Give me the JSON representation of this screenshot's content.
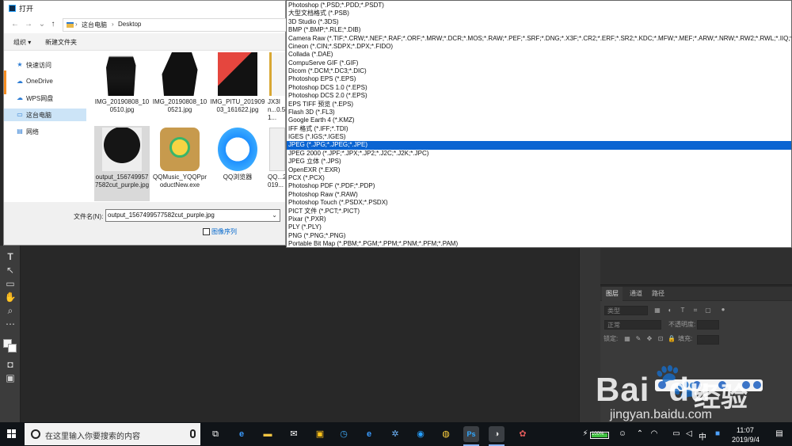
{
  "dialog": {
    "title": "打开",
    "breadcrumb": [
      "这台电脑",
      "Desktop"
    ],
    "organize_label": "组织 ▾",
    "new_folder_label": "新建文件夹",
    "nav_items": [
      {
        "label": "快速访问",
        "icon": "star-icon"
      },
      {
        "label": "OneDrive",
        "icon": "cloud-icon"
      },
      {
        "label": "WPS网盘",
        "icon": "cloud-drive-icon"
      },
      {
        "label": "这台电脑",
        "icon": "computer-icon"
      },
      {
        "label": "网络",
        "icon": "network-icon"
      }
    ],
    "files": [
      {
        "name": "IMG_20190808_100510.jpg",
        "thumb": "dark-photo"
      },
      {
        "name": "IMG_20190808_100521.jpg",
        "thumb": "dark-photo"
      },
      {
        "name": "IMG_PITU_20190903_161622.jpg",
        "thumb": "red-photo"
      },
      {
        "name": "JX3In...0.51...",
        "thumb": "partial"
      },
      {
        "name": "output_1567499577582cut_purple.jpg",
        "thumb": "dark-photo"
      },
      {
        "name": "QQMusic_YQQPproductNew.exe",
        "thumb": "qqmusic"
      },
      {
        "name": "QQ浏览器",
        "thumb": "qqbrowser"
      },
      {
        "name": "QQ...2019...",
        "thumb": "partial"
      }
    ],
    "filename_label": "文件名(N):",
    "filename_value": "output_1567499577582cut_purple.jpg",
    "sequence_label": "图像序列"
  },
  "formats": [
    "Photoshop (*.PSD;*.PDD;*.PSDT)",
    "大型文档格式 (*.PSB)",
    "3D Studio (*.3DS)",
    "BMP (*.BMP;*.RLE;*.DIB)",
    "Camera Raw (*.TIF;*.CRW;*.NEF;*.RAF;*.ORF;*.MRW;*.DCR;*.MOS;*.RAW;*.PEF;*.SRF;*.DNG;*.X3F;*.CR2;*.ERF;*.SR2;*.KDC;*.MFW;*.MEF;*.ARW;*.NRW;*.RW2;*.RWL;*.IIQ;*.3FR;*.FFF;*.SRW;*.GPR;*.DXO;*.ARQ;*.CR3)",
    "Cineon (*.CIN;*.SDPX;*.DPX;*.FIDO)",
    "Collada (*.DAE)",
    "CompuServe GIF (*.GIF)",
    "Dicom (*.DCM;*.DC3;*.DIC)",
    "Photoshop EPS (*.EPS)",
    "Photoshop DCS 1.0 (*.EPS)",
    "Photoshop DCS 2.0 (*.EPS)",
    "EPS TIFF 预览 (*.EPS)",
    "Flash 3D (*.FL3)",
    "Google Earth 4 (*.KMZ)",
    "IFF 格式 (*.IFF;*.TDI)",
    "IGES (*.IGS;*.IGES)",
    "JPEG (*.JPG;*.JPEG;*.JPE)",
    "JPEG 2000 (*.JPF;*.JPX;*.JP2;*.J2C;*.J2K;*.JPC)",
    "JPEG 立体 (*.JPS)",
    "OpenEXR (*.EXR)",
    "PCX (*.PCX)",
    "Photoshop PDF (*.PDF;*.PDP)",
    "Photoshop Raw (*.RAW)",
    "Photoshop Touch (*.PSDX;*.PSDX)",
    "PICT 文件 (*.PCT;*.PICT)",
    "Pixar (*.PXR)",
    "PLY (*.PLY)",
    "PNG (*.PNG;*.PNG)",
    "Portable Bit Map (*.PBM;*.PGM;*.PPM;*.PNM;*.PFM;*.PAM)"
  ],
  "selected_format_index": 17,
  "layers": {
    "tabs": [
      "图层",
      "通道",
      "路径"
    ],
    "kind_label": "类型",
    "mode_label": "正常",
    "opacity_label": "不透明度:",
    "lock_label": "锁定:",
    "fill_label": "填充:"
  },
  "watermark": {
    "logo": "Bai",
    "logo_tail": "du",
    "cn": "经验",
    "url": "jingyan.baidu.com"
  },
  "taskbar": {
    "search_placeholder": "在这里输入你要搜索的内容",
    "battery": "100%",
    "ime": "中",
    "time": "11:07",
    "date": "2019/9/4"
  },
  "colors": {
    "selection": "#0a64d2",
    "nav_selected": "#cce4f7",
    "ps_dark": "#282828"
  }
}
